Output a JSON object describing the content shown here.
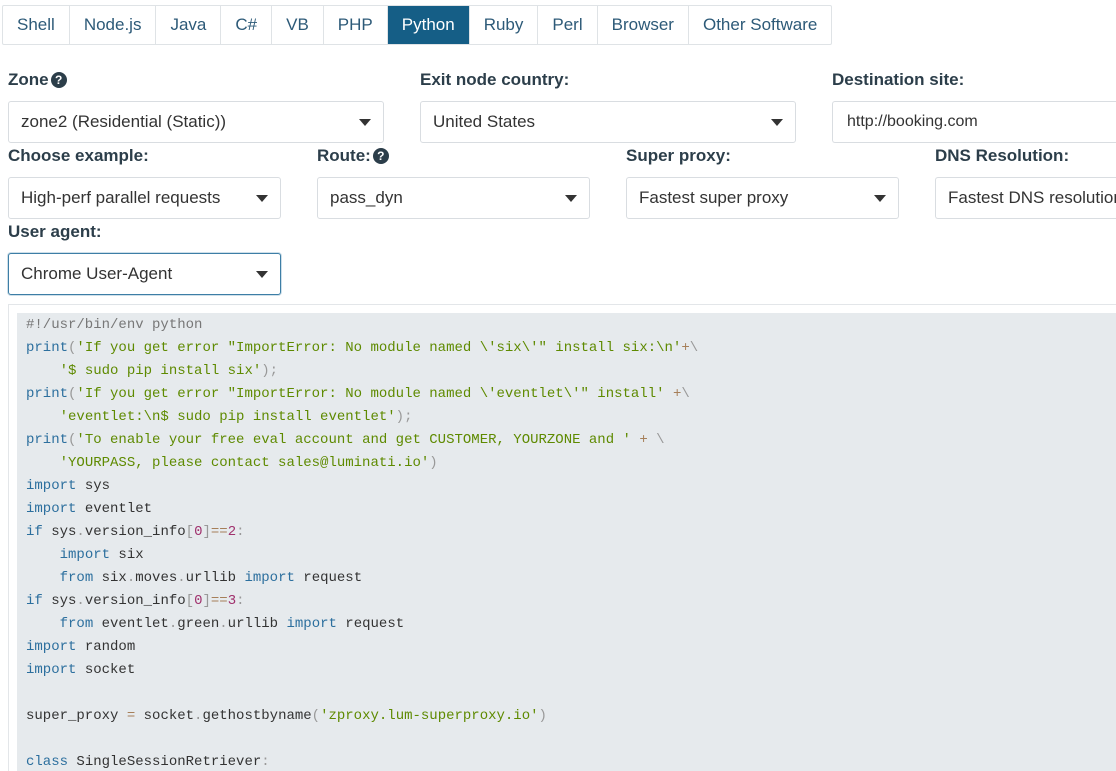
{
  "tabs": [
    "Shell",
    "Node.js",
    "Java",
    "C#",
    "VB",
    "PHP",
    "Python",
    "Ruby",
    "Perl",
    "Browser",
    "Other Software"
  ],
  "active_tab": "Python",
  "zone": {
    "label": "Zone",
    "value": "zone2 (Residential (Static))"
  },
  "exit_country": {
    "label": "Exit node country:",
    "value": "United States"
  },
  "destination": {
    "label": "Destination site:",
    "value": "http://booking.com"
  },
  "example": {
    "label": "Choose example:",
    "value": "High-perf parallel requests"
  },
  "route": {
    "label": "Route:",
    "value": "pass_dyn"
  },
  "super_proxy": {
    "label": "Super proxy:",
    "value": "Fastest super proxy"
  },
  "dns": {
    "label": "DNS Resolution:",
    "value": "Fastest DNS resolution"
  },
  "user_agent": {
    "label": "User agent:",
    "value": "Chrome User-Agent"
  },
  "code_lines": [
    [
      [
        "c",
        "#!/usr/bin/env python"
      ]
    ],
    [
      [
        "k",
        "print"
      ],
      [
        "p",
        "("
      ],
      [
        "s",
        "'If you get error \"ImportError: No module named \\'six\\'\" install six:\\n'"
      ],
      [
        "o",
        "+"
      ],
      [
        "p",
        "\\"
      ]
    ],
    [
      [
        "n",
        "    "
      ],
      [
        "s",
        "'$ sudo pip install six'"
      ],
      [
        "p",
        ");"
      ]
    ],
    [
      [
        "k",
        "print"
      ],
      [
        "p",
        "("
      ],
      [
        "s",
        "'If you get error \"ImportError: No module named \\'eventlet\\'\" install'"
      ],
      [
        "n",
        " "
      ],
      [
        "o",
        "+"
      ],
      [
        "p",
        "\\"
      ]
    ],
    [
      [
        "n",
        "    "
      ],
      [
        "s",
        "'eventlet:\\n$ sudo pip install eventlet'"
      ],
      [
        "p",
        ");"
      ]
    ],
    [
      [
        "k",
        "print"
      ],
      [
        "p",
        "("
      ],
      [
        "s",
        "'To enable your free eval account and get CUSTOMER, YOURZONE and '"
      ],
      [
        "n",
        " "
      ],
      [
        "o",
        "+"
      ],
      [
        "n",
        " "
      ],
      [
        "p",
        "\\"
      ]
    ],
    [
      [
        "n",
        "    "
      ],
      [
        "s",
        "'YOURPASS, please contact sales@luminati.io'"
      ],
      [
        "p",
        ")"
      ]
    ],
    [
      [
        "k",
        "import"
      ],
      [
        "n",
        " sys"
      ]
    ],
    [
      [
        "k",
        "import"
      ],
      [
        "n",
        " eventlet"
      ]
    ],
    [
      [
        "k",
        "if"
      ],
      [
        "n",
        " sys"
      ],
      [
        "p",
        "."
      ],
      [
        "n",
        "version_info"
      ],
      [
        "p",
        "["
      ],
      [
        "num",
        "0"
      ],
      [
        "p",
        "]"
      ],
      [
        "o",
        "=="
      ],
      [
        "num",
        "2"
      ],
      [
        "p",
        ":"
      ]
    ],
    [
      [
        "n",
        "    "
      ],
      [
        "k",
        "import"
      ],
      [
        "n",
        " six"
      ]
    ],
    [
      [
        "n",
        "    "
      ],
      [
        "k",
        "from"
      ],
      [
        "n",
        " six"
      ],
      [
        "p",
        "."
      ],
      [
        "n",
        "moves"
      ],
      [
        "p",
        "."
      ],
      [
        "n",
        "urllib "
      ],
      [
        "k",
        "import"
      ],
      [
        "n",
        " request"
      ]
    ],
    [
      [
        "k",
        "if"
      ],
      [
        "n",
        " sys"
      ],
      [
        "p",
        "."
      ],
      [
        "n",
        "version_info"
      ],
      [
        "p",
        "["
      ],
      [
        "num",
        "0"
      ],
      [
        "p",
        "]"
      ],
      [
        "o",
        "=="
      ],
      [
        "num",
        "3"
      ],
      [
        "p",
        ":"
      ]
    ],
    [
      [
        "n",
        "    "
      ],
      [
        "k",
        "from"
      ],
      [
        "n",
        " eventlet"
      ],
      [
        "p",
        "."
      ],
      [
        "n",
        "green"
      ],
      [
        "p",
        "."
      ],
      [
        "n",
        "urllib "
      ],
      [
        "k",
        "import"
      ],
      [
        "n",
        " request"
      ]
    ],
    [
      [
        "k",
        "import"
      ],
      [
        "n",
        " random"
      ]
    ],
    [
      [
        "k",
        "import"
      ],
      [
        "n",
        " socket"
      ]
    ],
    [],
    [
      [
        "n",
        "super_proxy "
      ],
      [
        "o",
        "="
      ],
      [
        "n",
        " socket"
      ],
      [
        "p",
        "."
      ],
      [
        "n",
        "gethostbyname"
      ],
      [
        "p",
        "("
      ],
      [
        "s",
        "'zproxy.lum-superproxy.io'"
      ],
      [
        "p",
        ")"
      ]
    ],
    [],
    [
      [
        "k",
        "class"
      ],
      [
        "n",
        " SingleSessionRetriever"
      ],
      [
        "p",
        ":"
      ]
    ]
  ]
}
